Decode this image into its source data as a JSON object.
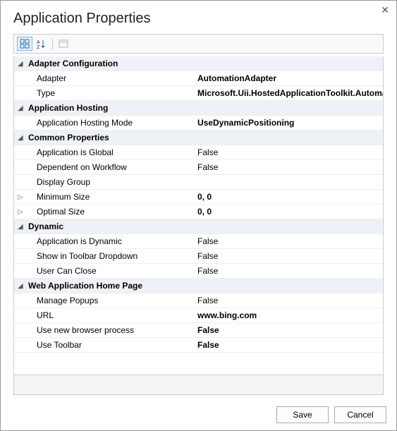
{
  "title": "Application Properties",
  "toolbar": {
    "categorized": "Categorized",
    "alphabetical": "Alphabetical",
    "property_pages": "Property Pages"
  },
  "categories": [
    {
      "name": "Adapter Configuration",
      "expanded": true,
      "props": [
        {
          "name": "Adapter",
          "value": "AutomationAdapter",
          "bold": true
        },
        {
          "name": "Type",
          "value": "Microsoft.Uii.HostedApplicationToolkit.AutomationAdapter",
          "bold": true
        }
      ]
    },
    {
      "name": "Application Hosting",
      "expanded": true,
      "props": [
        {
          "name": "Application Hosting Mode",
          "value": "UseDynamicPositioning",
          "bold": true
        }
      ]
    },
    {
      "name": "Common Properties",
      "expanded": true,
      "props": [
        {
          "name": "Application is Global",
          "value": "False",
          "bold": false
        },
        {
          "name": "Dependent on Workflow",
          "value": "False",
          "bold": false
        },
        {
          "name": "Display Group",
          "value": "",
          "bold": false
        },
        {
          "name": "Minimum Size",
          "value": "0, 0",
          "bold": true,
          "expandable": true
        },
        {
          "name": "Optimal Size",
          "value": "0, 0",
          "bold": true,
          "expandable": true
        }
      ]
    },
    {
      "name": "Dynamic",
      "expanded": true,
      "props": [
        {
          "name": "Application is Dynamic",
          "value": "False",
          "bold": false
        },
        {
          "name": "Show in Toolbar Dropdown",
          "value": "False",
          "bold": false
        },
        {
          "name": "User Can Close",
          "value": "False",
          "bold": false
        }
      ]
    },
    {
      "name": "Web Application Home Page",
      "expanded": true,
      "props": [
        {
          "name": "Manage Popups",
          "value": "False",
          "bold": false
        },
        {
          "name": "URL",
          "value": "www.bing.com",
          "bold": true
        },
        {
          "name": "Use new browser process",
          "value": "False",
          "bold": true
        },
        {
          "name": "Use Toolbar",
          "value": "False",
          "bold": true
        }
      ]
    }
  ],
  "buttons": {
    "save": "Save",
    "cancel": "Cancel"
  }
}
